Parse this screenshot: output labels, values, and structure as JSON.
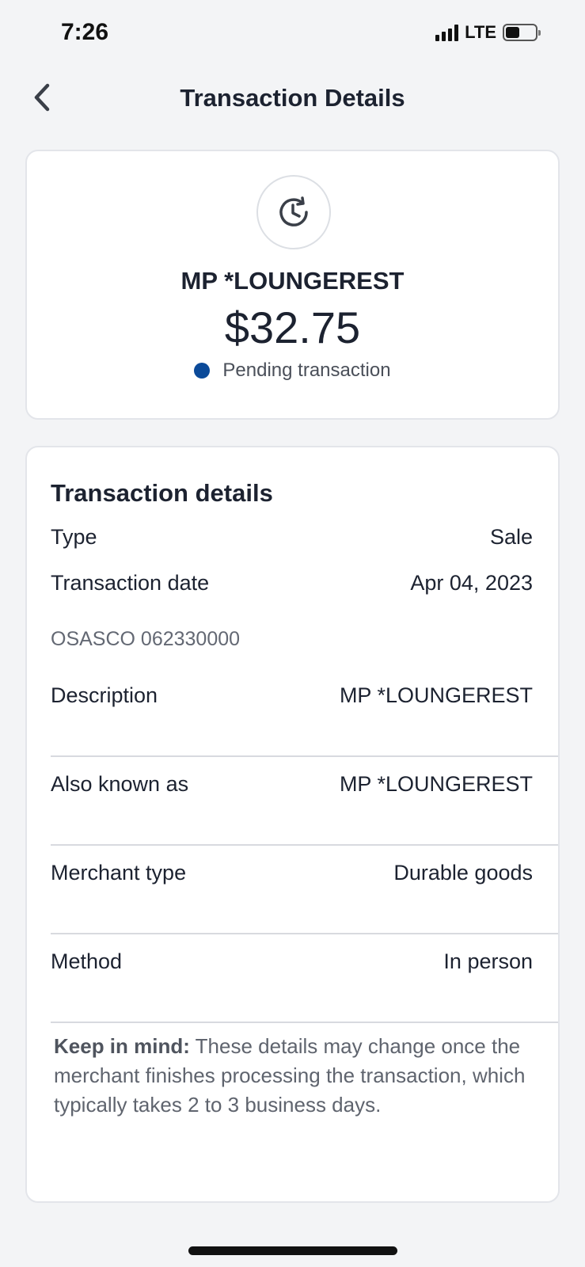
{
  "status_bar": {
    "time": "7:26",
    "network": "LTE"
  },
  "header": {
    "title": "Transaction Details",
    "back_icon": "chevron-left-icon"
  },
  "summary": {
    "status_icon": "pending-clock-icon",
    "merchant": "MP *LOUNGEREST",
    "amount": "$32.75",
    "status_label": "Pending transaction",
    "status_color": "#0b4a99"
  },
  "details": {
    "section_title": "Transaction details",
    "type_label": "Type",
    "type_value": "Sale",
    "date_label": "Transaction date",
    "date_value": "Apr 04, 2023",
    "location": "OSASCO 062330000",
    "rows": [
      {
        "label": "Description",
        "value": "MP *LOUNGEREST"
      },
      {
        "label": "Also known as",
        "value": "MP *LOUNGEREST"
      },
      {
        "label": "Merchant type",
        "value": "Durable goods"
      },
      {
        "label": "Method",
        "value": "In person"
      }
    ],
    "note_bold": "Keep in mind:",
    "note_text": " These details may change once the merchant finishes processing the transaction, which typically takes 2 to 3 business days."
  }
}
